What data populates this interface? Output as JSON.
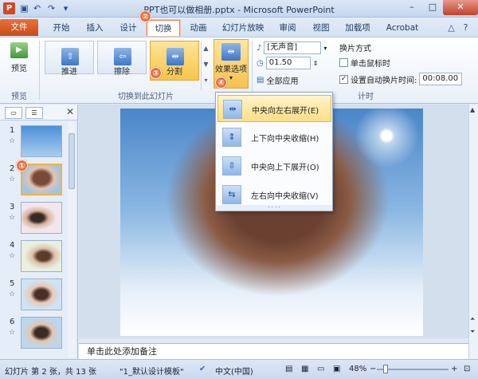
{
  "window": {
    "title": "PPT也可以做相册.pptx - Microsoft PowerPoint",
    "app_logo": "P",
    "quick_access": [
      "save-icon",
      "undo-icon",
      "redo-icon",
      "customize-icon"
    ],
    "controls": {
      "minimize": "–",
      "maximize": "□",
      "close": "✕"
    }
  },
  "tabs": [
    {
      "label": "文件",
      "key": "file"
    },
    {
      "label": "开始",
      "key": "home"
    },
    {
      "label": "插入",
      "key": "insert"
    },
    {
      "label": "设计",
      "key": "design"
    },
    {
      "label": "切换",
      "key": "transitions"
    },
    {
      "label": "动画",
      "key": "animations"
    },
    {
      "label": "幻灯片放映",
      "key": "slideshow"
    },
    {
      "label": "审阅",
      "key": "review"
    },
    {
      "label": "视图",
      "key": "view"
    },
    {
      "label": "加载项",
      "key": "addins"
    },
    {
      "label": "Acrobat",
      "key": "acrobat"
    }
  ],
  "ribbon": {
    "preview": {
      "button_label": "预览",
      "group_label": "预览"
    },
    "transition_gallery": {
      "group_label": "切换到此幻灯片",
      "items": [
        {
          "label": "推进",
          "icon": "push-transition-icon",
          "selected": false
        },
        {
          "label": "擦除",
          "icon": "wipe-transition-icon",
          "selected": false
        },
        {
          "label": "分割",
          "icon": "split-transition-icon",
          "selected": true
        }
      ],
      "effect_options_label": "效果选项"
    },
    "timing": {
      "group_label": "计时",
      "sound_value": "[无声音]",
      "duration_value": "01.50",
      "apply_all_label": "全部应用",
      "advance_header": "换片方式",
      "on_click_label": "单击鼠标时",
      "on_click_checked": false,
      "after_label": "设置自动换片时间:",
      "after_checked": true,
      "after_value": "00:08.00"
    }
  },
  "effect_menu": {
    "items": [
      {
        "label": "中央向左右展开(E)",
        "icon": "split-horizontal-out-icon",
        "selected": true
      },
      {
        "label": "上下向中央收缩(H)",
        "icon": "split-vertical-in-icon",
        "selected": false
      },
      {
        "label": "中央向上下展开(O)",
        "icon": "split-vertical-out-icon",
        "selected": false
      },
      {
        "label": "左右向中央收缩(V)",
        "icon": "split-horizontal-in-icon",
        "selected": false
      }
    ]
  },
  "slides_panel": {
    "thumbnails": [
      {
        "num": "1",
        "selected": false
      },
      {
        "num": "2",
        "selected": true
      },
      {
        "num": "3",
        "selected": false
      },
      {
        "num": "4",
        "selected": false
      },
      {
        "num": "5",
        "selected": false
      },
      {
        "num": "6",
        "selected": false
      }
    ]
  },
  "badges": {
    "b1": "①",
    "b2": "②",
    "b3": "③",
    "b4": "④"
  },
  "notes_placeholder": "单击此处添加备注",
  "statusbar": {
    "slide_info": "幻灯片 第 2 张，共 13 张",
    "theme": "\"1_默认设计模板\"",
    "language": "中文(中国)",
    "zoom": "48%"
  },
  "colors": {
    "file_tab": "#d24726",
    "accent_orange": "#e8703a",
    "selected_gold": "#f7c54b"
  }
}
